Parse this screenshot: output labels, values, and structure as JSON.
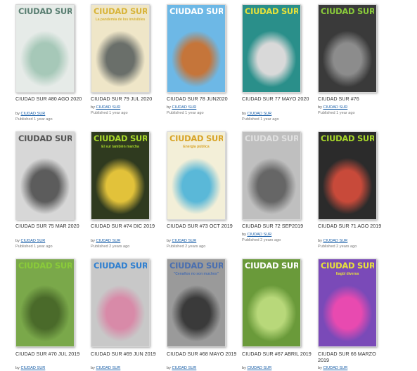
{
  "by_prefix": "by",
  "rows": [
    [
      {
        "title": "CIUDAD SUR #80 AGO 2020",
        "author": "CIUDAD SUR",
        "published": "Published 1 year ago",
        "masthead": "CIUDAD SUR",
        "headline": "",
        "colors": {
          "bg": "#e6ebe8",
          "art": "#a6c8b8",
          "masthead": "#5a7f72"
        }
      },
      {
        "title": "CIUDAD SUR 79 JUL 2020",
        "author": "CIUDAD SUR",
        "published": "Published 1 year ago",
        "masthead": "CIUDAD SUR",
        "headline": "La pandemia de los invisibles",
        "colors": {
          "bg": "#efe6c8",
          "art": "#6a6f6a",
          "masthead": "#d8b43a"
        }
      },
      {
        "title": "CIUDAD SUR 78 JUN2020",
        "author": "CIUDAD SUR",
        "published": "Published 1 year ago",
        "masthead": "CIUDAD SUR",
        "headline": "",
        "colors": {
          "bg": "#6db8e6",
          "art": "#c5753a",
          "masthead": "#ffffff"
        }
      },
      {
        "title": "CIUDAD SUR 77 MAYO 2020",
        "author": "CIUDAD SUR",
        "published": "Published 1 year ago",
        "masthead": "CIUDAD SUR",
        "headline": "",
        "colors": {
          "bg": "#2a8f8a",
          "art": "#d9d9d9",
          "masthead": "#e6e23a"
        }
      },
      {
        "title": "CIUDAD SUR #76",
        "author": "CIUDAD SUR",
        "published": "Published 1 year ago",
        "masthead": "CIUDAD SUR",
        "headline": "",
        "colors": {
          "bg": "#3a3a3a",
          "art": "#8c8c8c",
          "masthead": "#8acb3a"
        }
      }
    ],
    [
      {
        "title": "CIUDAD SUR 75 MAR 2020",
        "author": "CIUDAD SUR",
        "published": "Published 1 year ago",
        "masthead": "CIUDAD SUR",
        "headline": "",
        "colors": {
          "bg": "#d7d7d7",
          "art": "#5c5c5c",
          "masthead": "#555555"
        }
      },
      {
        "title": "CIUDAD SUR #74 DIC 2019",
        "author": "CIUDAD SUR",
        "published": "Published 2 years ago",
        "masthead": "CIUDAD SUR",
        "headline": "El sur también marcha",
        "colors": {
          "bg": "#2f3a1f",
          "art": "#e2c23a",
          "masthead": "#a8d82a"
        }
      },
      {
        "title": "CIUDAD SUR #73 OCT 2019",
        "author": "CIUDAD SUR",
        "published": "Published 2 years ago",
        "masthead": "CIUDAD SUR",
        "headline": "Energía pública",
        "colors": {
          "bg": "#f3efd8",
          "art": "#5ab8d8",
          "masthead": "#d8a428"
        }
      },
      {
        "title": "CIUDAD SUR 72 SEP2019",
        "author": "CIUDAD SUR",
        "published": "Published 2 years ago",
        "masthead": "CIUDAD SUR",
        "headline": "",
        "colors": {
          "bg": "#bfbfbf",
          "art": "#666666",
          "masthead": "#e0e0e0"
        }
      },
      {
        "title": "CIUDAD SUR 71 AGO 2019",
        "author": "CIUDAD SUR",
        "published": "Published 2 years ago",
        "masthead": "CIUDAD SUR",
        "headline": "",
        "colors": {
          "bg": "#2b2b2b",
          "art": "#c84a3a",
          "masthead": "#a8d82a"
        }
      }
    ],
    [
      {
        "title": "CIUDAD SUR #70 JUL 2019",
        "author": "CIUDAD SUR",
        "published": "",
        "masthead": "CIUDAD SUR",
        "headline": "",
        "colors": {
          "bg": "#7aa84a",
          "art": "#4a6a2a",
          "masthead": "#8acb3a"
        }
      },
      {
        "title": "CIUDAD SUR #69 JUN 2019",
        "author": "CIUDAD SUR",
        "published": "",
        "masthead": "CIUDAD SUR",
        "headline": "",
        "colors": {
          "bg": "#c8c8c8",
          "art": "#d88aa8",
          "masthead": "#2f7fd0"
        }
      },
      {
        "title": "CIUDAD SUR #68 MAYO 2019",
        "author": "CIUDAD SUR",
        "published": "",
        "masthead": "CIUDAD SUR",
        "headline": "\"Cenaños no son muchos\"",
        "colors": {
          "bg": "#9a9a9a",
          "art": "#3a3a3a",
          "masthead": "#4a6fb0"
        }
      },
      {
        "title": "CIUDAD SUR #67 ABRIL 2019",
        "author": "CIUDAD SUR",
        "published": "",
        "masthead": "CIUDAD SUR",
        "headline": "",
        "colors": {
          "bg": "#6a9a3a",
          "art": "#b8d87a",
          "masthead": "#ffffff"
        }
      },
      {
        "title": "CIUDAD SUR 66 MARZO 2019",
        "author": "CIUDAD SUR",
        "published": "",
        "masthead": "CIUDAD SUR",
        "headline": "Itagüí diversa",
        "colors": {
          "bg": "#7a4ab8",
          "art": "#e84ab0",
          "masthead": "#e8e23a"
        }
      }
    ]
  ]
}
